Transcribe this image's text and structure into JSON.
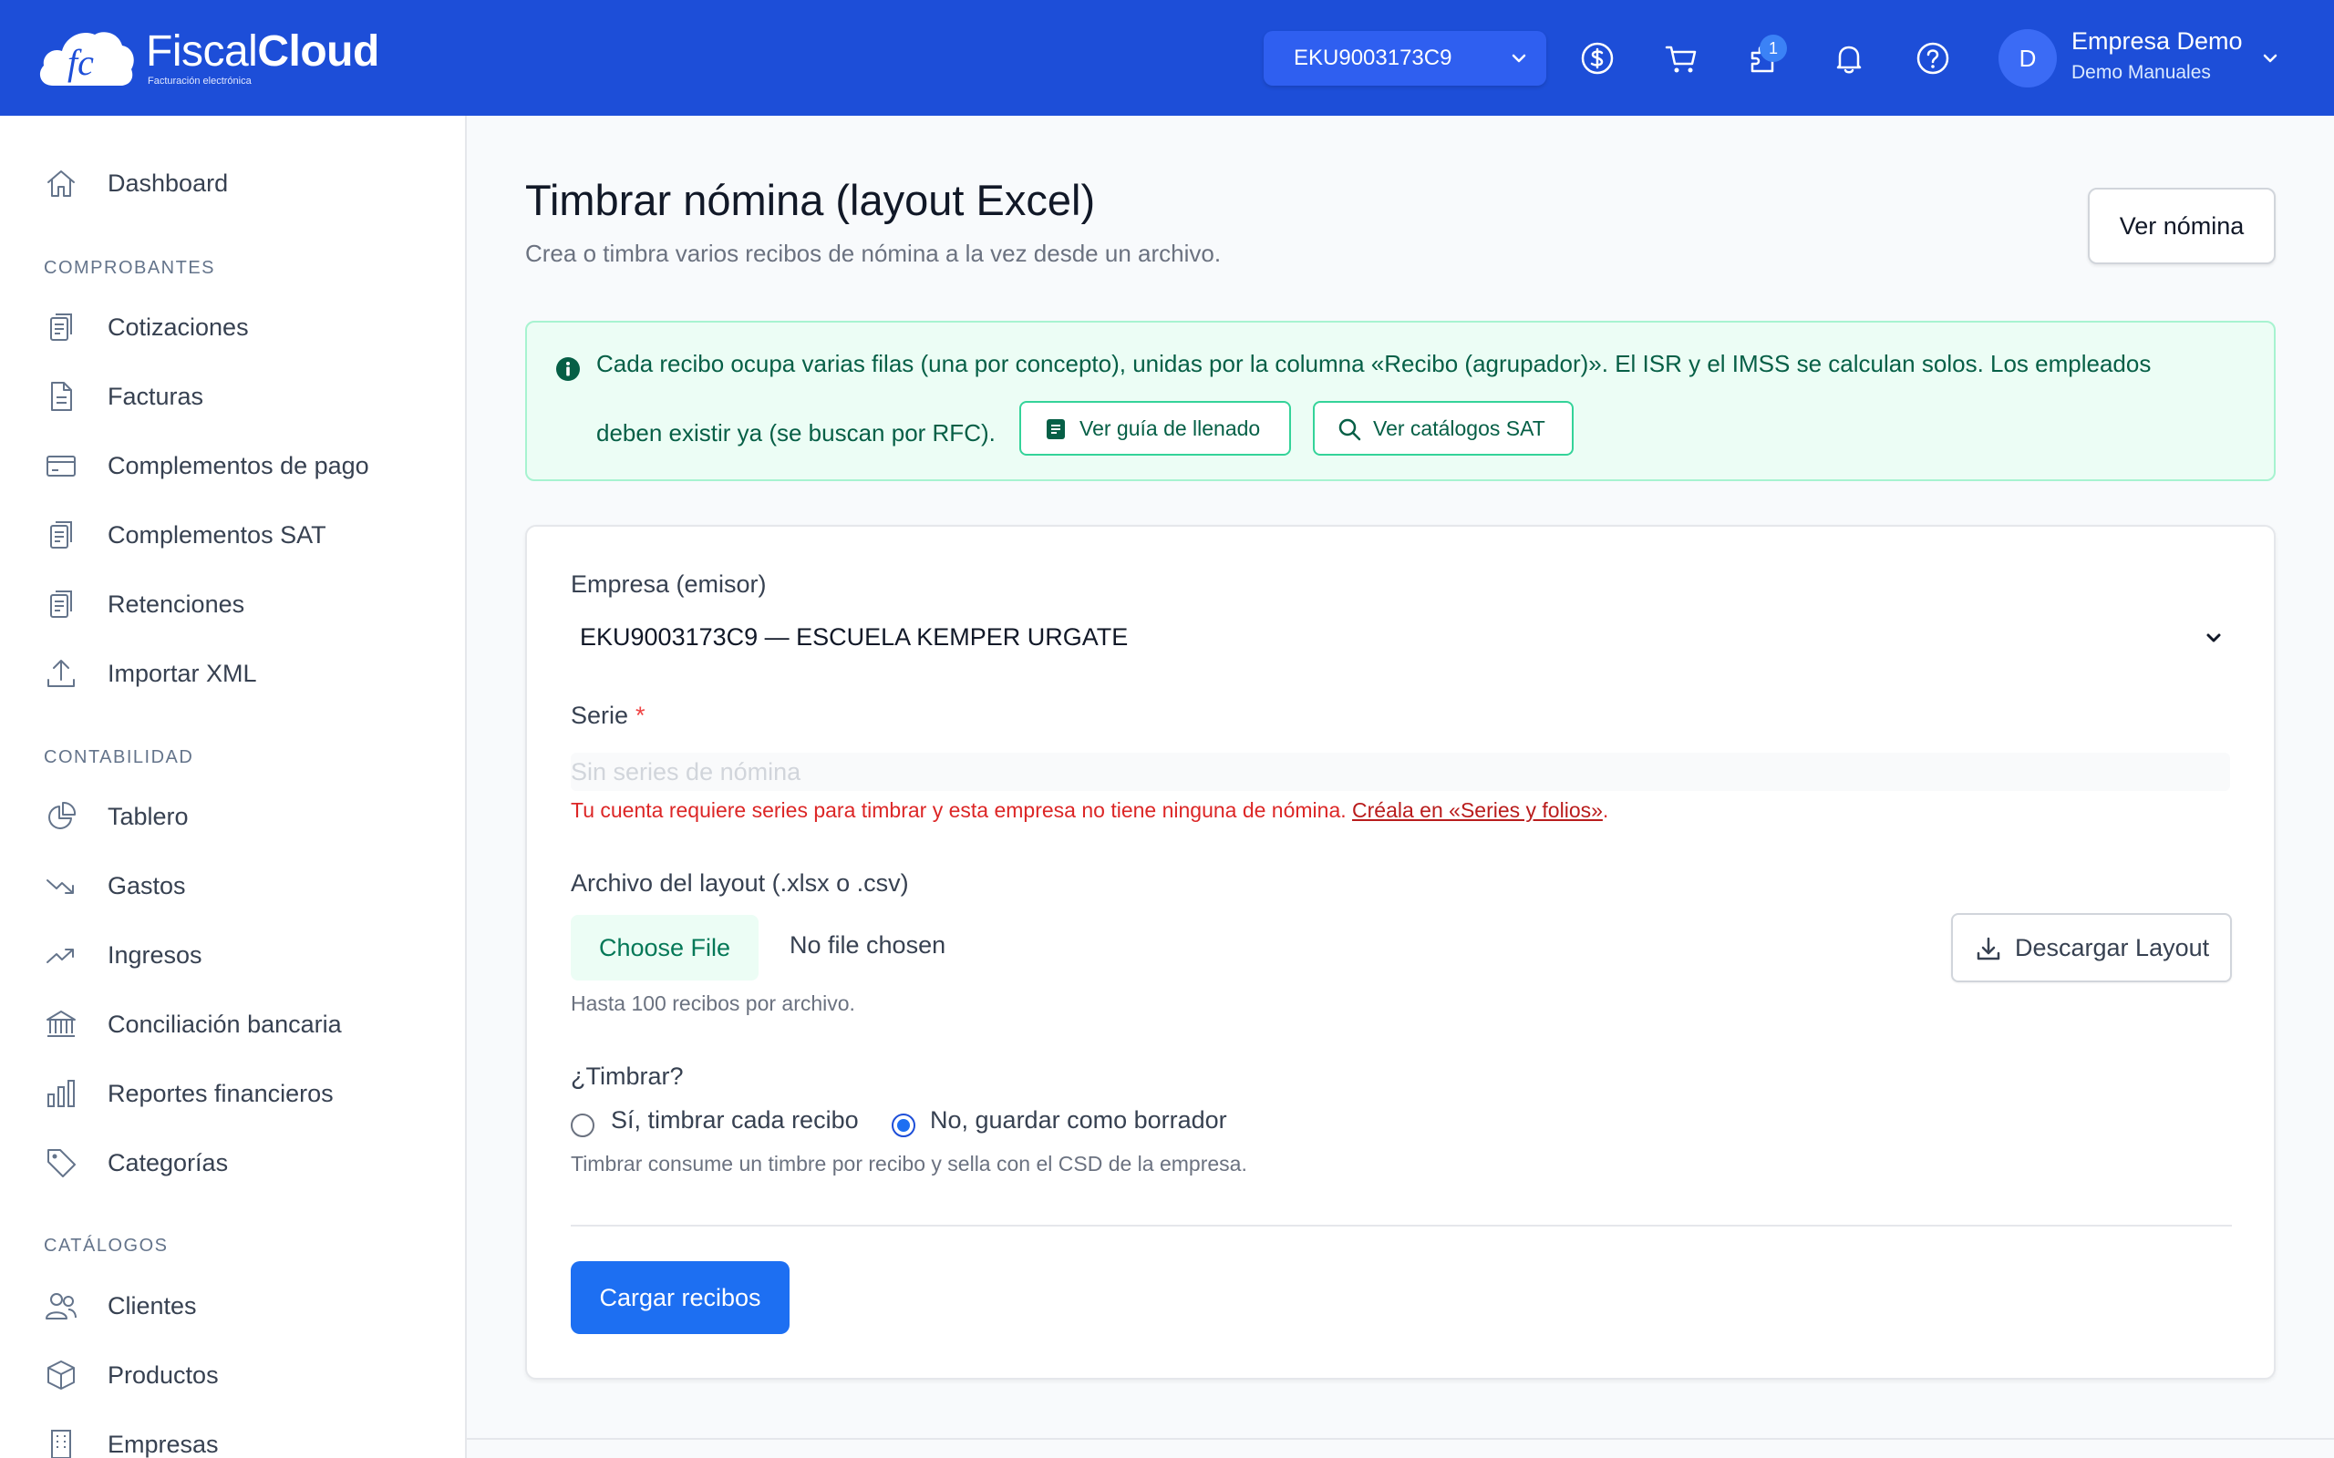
{
  "app": {
    "brand_light": "Fiscal",
    "brand_bold": "Cloud",
    "brand_sub": "Facturación electrónica",
    "logo_mark": "fc"
  },
  "topbar": {
    "rfc_selected": "EKU9003173C9",
    "cart_badge": "1",
    "user_initial": "D",
    "user_name": "Empresa Demo",
    "user_sub": "Demo Manuales",
    "icons": [
      "dollar-icon",
      "cart-icon",
      "puzzle-icon",
      "bell-icon",
      "help-icon"
    ]
  },
  "sidebar": {
    "dashboard": "Dashboard",
    "sections": {
      "comprobantes": "COMPROBANTES",
      "contabilidad": "CONTABILIDAD",
      "catalogos": "CATÁLOGOS"
    },
    "items": {
      "cotizaciones": "Cotizaciones",
      "facturas": "Facturas",
      "complementos_pago": "Complementos de pago",
      "complementos_sat": "Complementos SAT",
      "retenciones": "Retenciones",
      "importar_xml": "Importar XML",
      "tablero": "Tablero",
      "gastos": "Gastos",
      "ingresos": "Ingresos",
      "conciliacion": "Conciliación bancaria",
      "reportes": "Reportes financieros",
      "categorias": "Categorías",
      "clientes": "Clientes",
      "productos": "Productos",
      "empresas": "Empresas"
    }
  },
  "page": {
    "title": "Timbrar nómina (layout Excel)",
    "subtitle": "Crea o timbra varios recibos de nómina a la vez desde un archivo.",
    "ver_nomina": "Ver nómina"
  },
  "alert": {
    "line1": "Cada recibo ocupa varias filas (una por concepto), unidas por la columna «Recibo (agrupador)». El ISR y el IMSS se calculan solos. Los empleados",
    "line2": "deben existir ya (se buscan por RFC).",
    "guide_btn": "Ver guía de llenado",
    "catalog_btn": "Ver catálogos SAT"
  },
  "form": {
    "empresa_label": "Empresa (emisor)",
    "empresa_value": "EKU9003173C9 — ESCUELA KEMPER URGATE",
    "serie_label": "Serie",
    "serie_required": "*",
    "serie_placeholder": "Sin series de nómina",
    "serie_error": "Tu cuenta requiere series para timbrar y esta empresa no tiene ninguna de nómina.",
    "serie_error_link": "Créala en «Series y folios»",
    "serie_error_end": ".",
    "archivo_label": "Archivo del layout (.xlsx o .csv)",
    "choose_file": "Choose File",
    "no_file": "No file chosen",
    "download_layout": "Descargar Layout",
    "archivo_hint": "Hasta 100 recibos por archivo.",
    "timbrar_label": "¿Timbrar?",
    "radio_yes": "Sí, timbrar cada recibo",
    "radio_no": "No, guardar como borrador",
    "radio_selected": "no",
    "timbrar_hint": "Timbrar consume un timbre por recibo y sella con el CSD de la empresa.",
    "submit": "Cargar recibos"
  },
  "colors": {
    "topbar": "#1d4ed8",
    "primary_button": "#1d6ff2",
    "alert_bg": "#ecfdf5",
    "alert_text": "#065f46",
    "error": "#dc2626"
  }
}
